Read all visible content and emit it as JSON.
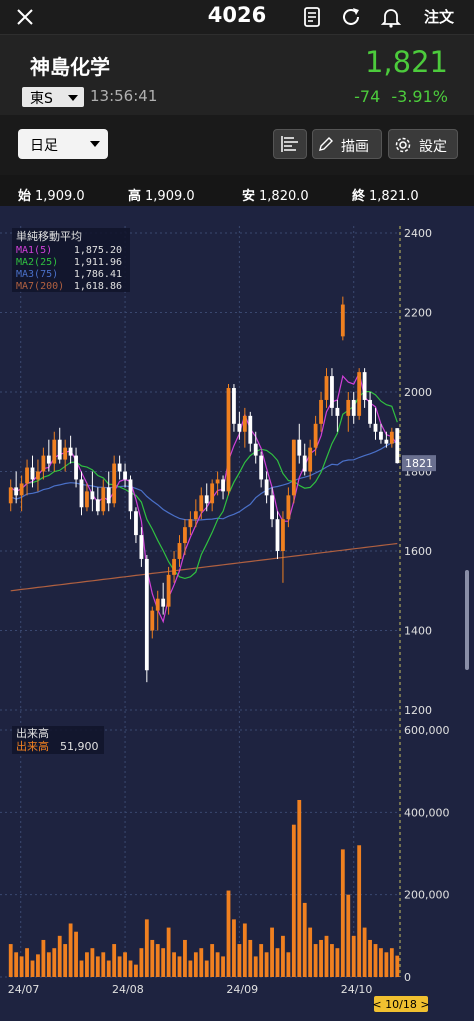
{
  "topbar": {
    "ticker": "4026",
    "order_label": "注文",
    "icons": [
      "close-icon",
      "document-icon",
      "refresh-icon",
      "bell-icon"
    ]
  },
  "header": {
    "company": "神島化学",
    "exchange": "東S",
    "time": "13:56:41",
    "price": "1,821",
    "change": "-74",
    "change_pct": "-3.91%",
    "accent": "#4ccb3c"
  },
  "controls": {
    "period": "日足",
    "draw_label": "描画",
    "settings_label": "設定"
  },
  "ohlc": {
    "open_label": "始",
    "open": "1,909.0",
    "high_label": "高",
    "high": "1,909.0",
    "low_label": "安",
    "low": "1,820.0",
    "close_label": "終",
    "close": "1,821.0"
  },
  "chart_data": {
    "type": "candlestick",
    "price_axis": {
      "min": 1200,
      "max": 2400,
      "ticks": [
        "2400",
        "2200",
        "2000",
        "1800",
        "1600",
        "1400",
        "1200"
      ],
      "current_label": "1821"
    },
    "volume_axis": {
      "min": 0,
      "max": 600000,
      "ticks": [
        "600,000",
        "400,000",
        "200,000",
        "0"
      ]
    },
    "x_labels": [
      "24/07",
      "24/08",
      "24/09",
      "24/10"
    ],
    "date_badge": "< 10/18 >",
    "legend_title": "単純移動平均",
    "ma": [
      {
        "label": "MA1(5)",
        "value": "1,875.20",
        "color": "#d040d8"
      },
      {
        "label": "MA2(25)",
        "value": "1,911.96",
        "color": "#30c040"
      },
      {
        "label": "MA3(75)",
        "value": "1,786.41",
        "color": "#4a70c8"
      },
      {
        "label": "MA7(200)",
        "value": "1,618.86",
        "color": "#b06040"
      }
    ],
    "volume_title": "出来高",
    "volume_label": "出来高",
    "volume_value": "51,900",
    "colors": {
      "up": "#f08020",
      "down": "#ffffff",
      "grid": "#3a4870",
      "text": "#e0e0e0"
    },
    "candles": [
      [
        1720,
        1780,
        1700,
        1760
      ],
      [
        1760,
        1800,
        1720,
        1740
      ],
      [
        1740,
        1790,
        1700,
        1770
      ],
      [
        1770,
        1830,
        1740,
        1810
      ],
      [
        1810,
        1840,
        1760,
        1780
      ],
      [
        1780,
        1830,
        1750,
        1800
      ],
      [
        1800,
        1860,
        1780,
        1840
      ],
      [
        1840,
        1880,
        1800,
        1820
      ],
      [
        1820,
        1900,
        1800,
        1880
      ],
      [
        1880,
        1910,
        1820,
        1830
      ],
      [
        1830,
        1880,
        1800,
        1860
      ],
      [
        1860,
        1890,
        1820,
        1840
      ],
      [
        1840,
        1860,
        1760,
        1780
      ],
      [
        1780,
        1800,
        1690,
        1710
      ],
      [
        1710,
        1770,
        1700,
        1750
      ],
      [
        1750,
        1800,
        1700,
        1730
      ],
      [
        1730,
        1760,
        1690,
        1700
      ],
      [
        1700,
        1780,
        1690,
        1760
      ],
      [
        1760,
        1800,
        1700,
        1720
      ],
      [
        1720,
        1840,
        1710,
        1820
      ],
      [
        1820,
        1840,
        1780,
        1800
      ],
      [
        1800,
        1820,
        1760,
        1780
      ],
      [
        1780,
        1790,
        1680,
        1700
      ],
      [
        1700,
        1710,
        1620,
        1640
      ],
      [
        1640,
        1660,
        1560,
        1580
      ],
      [
        1580,
        1590,
        1270,
        1300
      ],
      [
        1400,
        1460,
        1380,
        1450
      ],
      [
        1450,
        1500,
        1400,
        1480
      ],
      [
        1480,
        1520,
        1440,
        1460
      ],
      [
        1460,
        1560,
        1440,
        1540
      ],
      [
        1540,
        1600,
        1520,
        1580
      ],
      [
        1580,
        1640,
        1560,
        1620
      ],
      [
        1620,
        1680,
        1590,
        1660
      ],
      [
        1660,
        1700,
        1640,
        1680
      ],
      [
        1680,
        1730,
        1660,
        1700
      ],
      [
        1700,
        1760,
        1680,
        1740
      ],
      [
        1740,
        1770,
        1700,
        1720
      ],
      [
        1720,
        1780,
        1700,
        1770
      ],
      [
        1770,
        1800,
        1740,
        1780
      ],
      [
        1780,
        1790,
        1730,
        1750
      ],
      [
        1750,
        2020,
        1740,
        2010
      ],
      [
        2010,
        2020,
        1900,
        1920
      ],
      [
        1920,
        1950,
        1880,
        1900
      ],
      [
        1900,
        1960,
        1860,
        1940
      ],
      [
        1940,
        1950,
        1850,
        1870
      ],
      [
        1870,
        1900,
        1820,
        1840
      ],
      [
        1840,
        1850,
        1760,
        1780
      ],
      [
        1780,
        1800,
        1720,
        1740
      ],
      [
        1740,
        1760,
        1660,
        1680
      ],
      [
        1680,
        1700,
        1580,
        1600
      ],
      [
        1600,
        1700,
        1520,
        1680
      ],
      [
        1680,
        1760,
        1660,
        1740
      ],
      [
        1740,
        1880,
        1720,
        1880
      ],
      [
        1880,
        1920,
        1820,
        1840
      ],
      [
        1840,
        1870,
        1790,
        1800
      ],
      [
        1800,
        1880,
        1780,
        1860
      ],
      [
        1860,
        1940,
        1840,
        1920
      ],
      [
        1920,
        2000,
        1900,
        1980
      ],
      [
        1980,
        2060,
        1960,
        2040
      ],
      [
        2040,
        2060,
        1940,
        1960
      ],
      [
        1960,
        1980,
        1900,
        1940
      ],
      [
        2140,
        2240,
        2130,
        2220
      ],
      [
        1940,
        2000,
        1900,
        1980
      ],
      [
        1980,
        2000,
        1920,
        1940
      ],
      [
        1940,
        2060,
        1930,
        2050
      ],
      [
        2050,
        2060,
        1960,
        1980
      ],
      [
        1980,
        2000,
        1910,
        1920
      ],
      [
        1920,
        1960,
        1880,
        1900
      ],
      [
        1900,
        1920,
        1870,
        1880
      ],
      [
        1880,
        1900,
        1860,
        1870
      ],
      [
        1870,
        1910,
        1860,
        1900
      ],
      [
        1909,
        1909,
        1820,
        1821
      ]
    ],
    "volumes": [
      80000,
      60000,
      50000,
      70000,
      40000,
      55000,
      90000,
      60000,
      70000,
      100000,
      80000,
      130000,
      110000,
      40000,
      60000,
      70000,
      50000,
      60000,
      40000,
      80000,
      50000,
      60000,
      40000,
      30000,
      70000,
      140000,
      90000,
      80000,
      70000,
      120000,
      60000,
      50000,
      90000,
      40000,
      60000,
      70000,
      40000,
      80000,
      60000,
      50000,
      210000,
      140000,
      80000,
      130000,
      90000,
      50000,
      80000,
      60000,
      120000,
      70000,
      100000,
      60000,
      370000,
      430000,
      180000,
      120000,
      80000,
      90000,
      100000,
      80000,
      70000,
      310000,
      200000,
      100000,
      320000,
      120000,
      90000,
      80000,
      70000,
      60000,
      70000,
      51900
    ]
  }
}
